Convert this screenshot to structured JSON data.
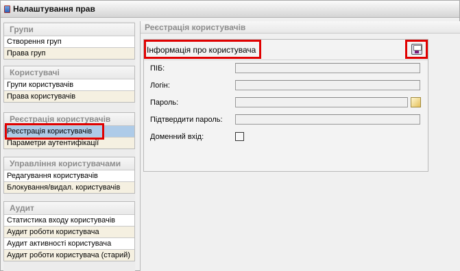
{
  "window": {
    "title": "Налаштування прав"
  },
  "sidebar": {
    "groups": [
      {
        "header": "Групи",
        "items": [
          "Створення груп",
          "Права груп"
        ]
      },
      {
        "header": "Користувачі",
        "items": [
          "Групи користувачів",
          "Права користувачів"
        ]
      },
      {
        "header": "Реєстрація користувачів",
        "items": [
          "Реєстрація користувачів",
          "Параметри аутентифікації"
        ]
      },
      {
        "header": "Управління користувачами",
        "items": [
          "Редагування користувачів",
          "Блокування/видал. користувачів"
        ]
      },
      {
        "header": "Аудит",
        "items": [
          "Статистика входу користувачів",
          "Аудит роботи користувача",
          "Аудит активності користувача",
          "Аудит роботи користувача (старий)"
        ]
      }
    ],
    "selected_item": "Реєстрація користувачів"
  },
  "main": {
    "header": "Реєстрація користувачів",
    "panel_title": "Інформація про користувача",
    "fields": {
      "name_label": "ПІБ:",
      "login_label": "Логін:",
      "password_label": "Пароль:",
      "confirm_password_label": "Підтвердити пароль:",
      "domain_login_label": "Доменний вхід:"
    },
    "icons": {
      "save": "save-icon",
      "password_generate": "key-icon"
    }
  },
  "colors": {
    "highlight": "#e00000",
    "selected_row": "#aecbe8",
    "alt_row": "#f5f0e1"
  }
}
